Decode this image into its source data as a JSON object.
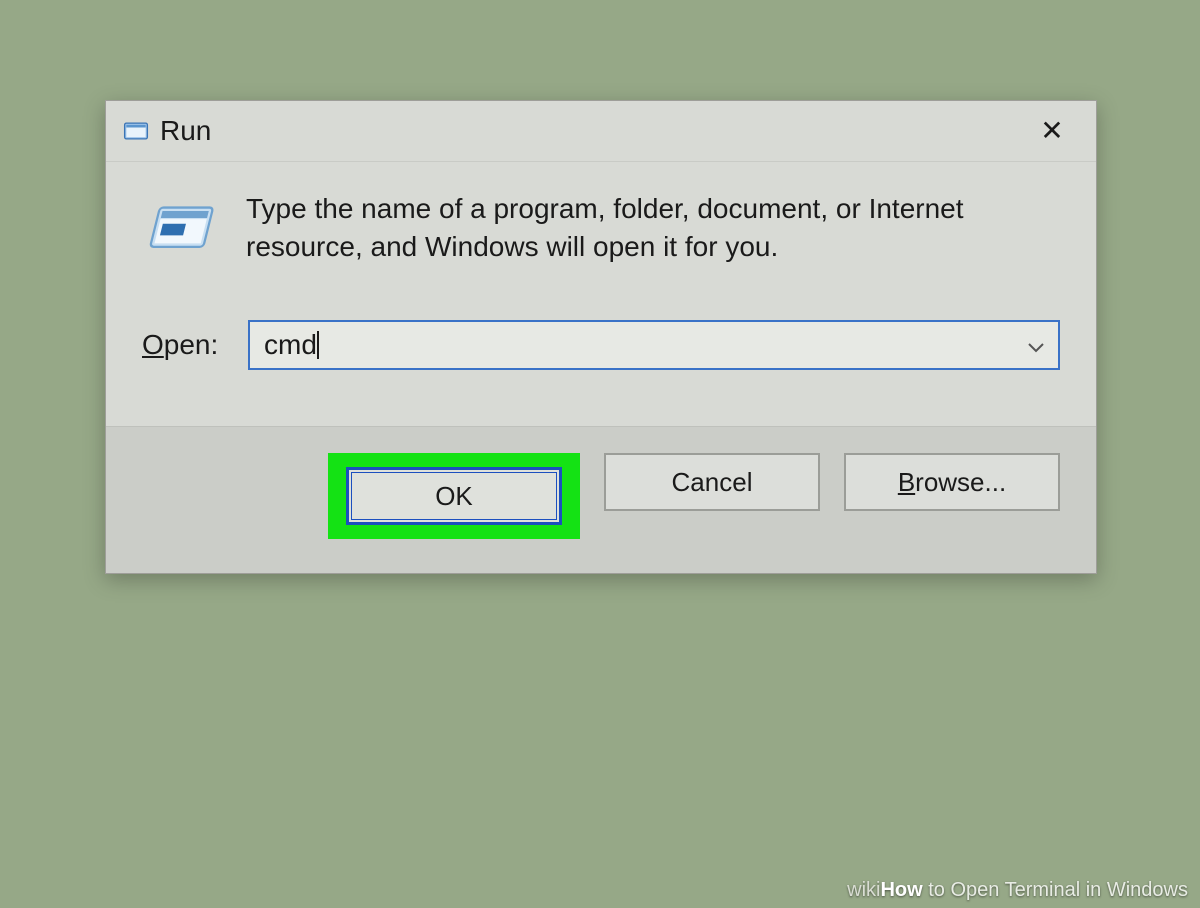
{
  "dialog": {
    "title": "Run",
    "close_glyph": "✕",
    "description": "Type the name of a program, folder, document, or Internet resource, and Windows will open it for you.",
    "open_label_pre": "O",
    "open_label_post": "pen:",
    "input_value": "cmd",
    "buttons": {
      "ok": "OK",
      "cancel": "Cancel",
      "browse_pre": "B",
      "browse_post": "rowse..."
    }
  },
  "watermark": {
    "wiki": "wiki",
    "how": "How",
    "caption": " to Open Terminal in Windows"
  }
}
